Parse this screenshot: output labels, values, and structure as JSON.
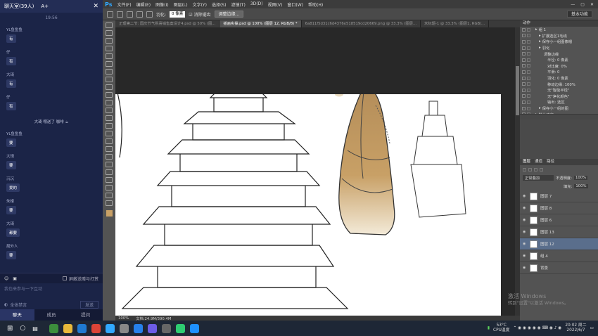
{
  "chat": {
    "title": "聊天室(39人)",
    "font_btn": "A+",
    "time": "19:56",
    "messages": [
      {
        "name": "YL鱼鱼鱼",
        "text": "有"
      },
      {
        "name": "仔",
        "text": "有"
      },
      {
        "name": "大琦",
        "text": "有"
      },
      {
        "name": "仔",
        "text": "有"
      }
    ],
    "notice": "大琦 喂送了 咖啡",
    "messages2": [
      {
        "name": "YL鱼鱼鱼",
        "text": "要"
      },
      {
        "name": "大琦",
        "text": "要"
      },
      {
        "name": "沉沉",
        "text": "爱的"
      },
      {
        "name": "朱楼",
        "text": "要"
      },
      {
        "name": "大琦",
        "text": "都要"
      },
      {
        "name": "局外人",
        "text": "要"
      }
    ],
    "only_teacher": "屏蔽送赠与打赏",
    "input_placeholder": "我也来参与一下互动",
    "mute_all": "全体禁言",
    "send": "发送",
    "tabs": [
      "聊天",
      "成员",
      "提问"
    ]
  },
  "ps": {
    "menu": [
      "文件(F)",
      "编辑(E)",
      "图像(I)",
      "图层(L)",
      "文字(Y)",
      "选择(S)",
      "滤镜(T)",
      "3D(D)",
      "视图(V)",
      "窗口(W)",
      "帮助(H)"
    ],
    "options": {
      "feather_label": "羽化:",
      "feather_value": "0 像素",
      "antialias": "消除锯齿",
      "refine": "调整边缘...",
      "workspace": "基本功能"
    },
    "tabs": [
      "正理第二节: 国庆节气氛喜销售案设计4.psd @ 50% (图...",
      "插画实操.psd @ 100% (图层 12, RGB/8) *",
      "6a811f5d31c6d4376e518519cd20669.png @ 33.3% (图层...",
      "未标题-1 @ 33.3% (图层1, RGB/..."
    ],
    "status": {
      "zoom": "100%",
      "doc": "文档:24.9M/390.4M"
    },
    "actions_title": "动作",
    "actions": [
      {
        "indent": 1,
        "text": "组 1"
      },
      {
        "indent": 2,
        "text": "扩展选区1毛线"
      },
      {
        "indent": 2,
        "text": "保存小一组图像帽"
      },
      {
        "indent": 2,
        "text": "羽化"
      },
      {
        "indent": 3,
        "text": "调整边缘"
      },
      {
        "indent": 4,
        "text": "半径: 0 像素"
      },
      {
        "indent": 4,
        "text": "对比度: 0%"
      },
      {
        "indent": 4,
        "text": "平滑: 0"
      },
      {
        "indent": 4,
        "text": "羽化: 0 像素"
      },
      {
        "indent": 4,
        "text": "移动边缘: 100%"
      },
      {
        "indent": 4,
        "text": "无\"智能半径\""
      },
      {
        "indent": 4,
        "text": "无\"净化颜色\""
      },
      {
        "indent": 4,
        "text": "输出: 选区"
      },
      {
        "indent": 2,
        "text": "保存小一组的图"
      },
      {
        "indent": 1,
        "text": "默认动作"
      }
    ],
    "layers_tabs": [
      "图层",
      "通道",
      "路径"
    ],
    "blend": "正常叠加",
    "opacity_label": "不透明度:",
    "opacity": "100%",
    "fill_label": "填充:",
    "fill": "100%",
    "layers": [
      {
        "name": "图层 7",
        "sel": false
      },
      {
        "name": "图层 8",
        "sel": false
      },
      {
        "name": "图层 6",
        "sel": false
      },
      {
        "name": "图层 13",
        "sel": false
      },
      {
        "name": "图层 12",
        "sel": true
      },
      {
        "name": "组 4",
        "sel": false
      },
      {
        "name": "背景",
        "sel": false
      }
    ]
  },
  "watermark": {
    "line1": "激活 Windows",
    "line2": "转到\"设置\"以激活 Windows。"
  },
  "taskbar": {
    "temp": "53°C",
    "cpu": "CPU温度",
    "time": "20:02 周二",
    "date": "2022/6/7"
  },
  "colors": {
    "chat_bg": "#1b2447",
    "ps_bg": "#282828",
    "accent": "#31a8ff"
  }
}
